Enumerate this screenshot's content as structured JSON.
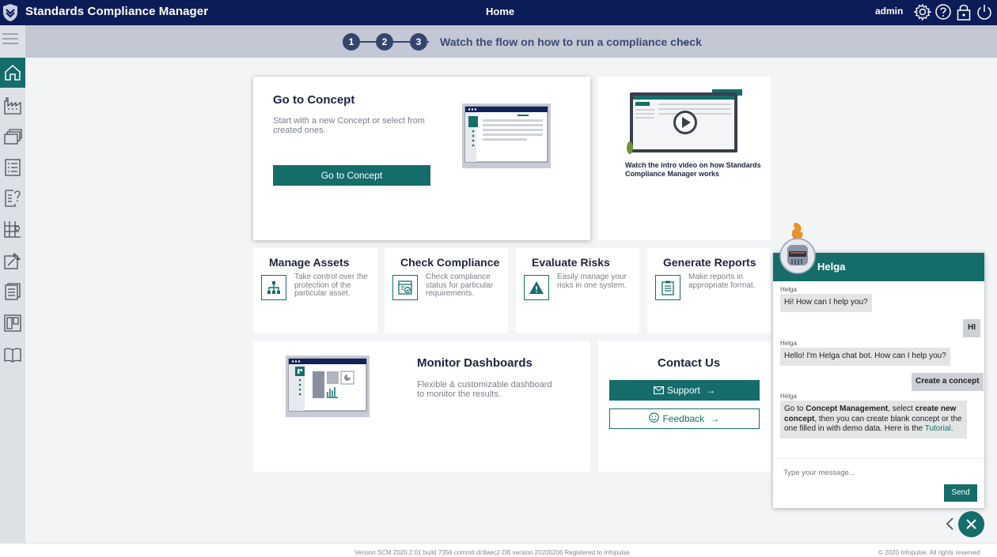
{
  "header": {
    "app_title": "Standards Compliance Manager",
    "page_title": "Home",
    "user": "admin",
    "icons": [
      "shield-logo-icon",
      "gear-icon",
      "help-icon",
      "lock-icon",
      "power-icon"
    ]
  },
  "sidebar": {
    "items": [
      {
        "name": "home",
        "icon": "home-icon"
      },
      {
        "name": "assets",
        "icon": "factory-icon"
      },
      {
        "name": "concepts",
        "icon": "stack-icon"
      },
      {
        "name": "checklist",
        "icon": "checklist-icon"
      },
      {
        "name": "questions",
        "icon": "question-doc-icon"
      },
      {
        "name": "risks",
        "icon": "grid-icon"
      },
      {
        "name": "measures",
        "icon": "pin-icon"
      },
      {
        "name": "reports",
        "icon": "report-icon"
      },
      {
        "name": "dashboards",
        "icon": "dashboard-icon"
      },
      {
        "name": "library",
        "icon": "book-icon"
      }
    ]
  },
  "stepper": {
    "steps": [
      "1",
      "2",
      "3"
    ],
    "text": "Watch the flow on how to run a compliance check",
    "arrow": "→"
  },
  "concept_card": {
    "title": "Go to Concept",
    "desc_line1": "Start with a new Concept or select from",
    "desc_line2": "created ones.",
    "button": "Go to Concept"
  },
  "video_card": {
    "line1": "Watch the intro video on how Standards",
    "line2": "Compliance Manager works"
  },
  "small_cards": [
    {
      "title": "Manage Assets",
      "l1": "Take control over the",
      "l2": "protection of the",
      "l3": "particular asset."
    },
    {
      "title": "Check Compliance",
      "l1": "Check compliance",
      "l2": "status for particular",
      "l3": "requirements."
    },
    {
      "title": "Evaluate Risks",
      "l1": "Easily manage your",
      "l2": "risks in one system.",
      "l3": ""
    },
    {
      "title": "Generate Reports",
      "l1": "Make reports in",
      "l2": "appropriate format.",
      "l3": ""
    }
  ],
  "dashboards_card": {
    "title": "Monitor Dashboards",
    "line1": "Flexible & customizable dashboard",
    "line2": "to monitor the results."
  },
  "contact_card": {
    "title": "Contact Us",
    "support": "Support",
    "feedback": "Feedback",
    "arrow": "→"
  },
  "chat": {
    "bot_name": "Helga",
    "sender": "Helga",
    "msg1": "Hi! How can I help you?",
    "user1": "HI",
    "msg2": "Hello! I'm Helga chat bot. How can I help you?",
    "user2": "Create a concept",
    "msg3_a": "Go to ",
    "msg3_b": "Concept Management",
    "msg3_c": ", select ",
    "msg3_d": "create new concept",
    "msg3_e": ", then you can create blank concept or the one filled in with demo data. Here is the ",
    "msg3_f": "Tutorial",
    "msg3_g": ".",
    "placeholder": "Type your message...",
    "send": "Send"
  },
  "footer": {
    "version": "Version SCM 2020.2.01 build 7356 commit dc8aec2   DB version 20200206   Registered to Infopulse",
    "copyright": "© 2020 Infopulse. All rights reserved"
  },
  "colors": {
    "header": "#0c1c56",
    "accent": "#156d6a",
    "stepper_bg": "#c4c8d4"
  }
}
